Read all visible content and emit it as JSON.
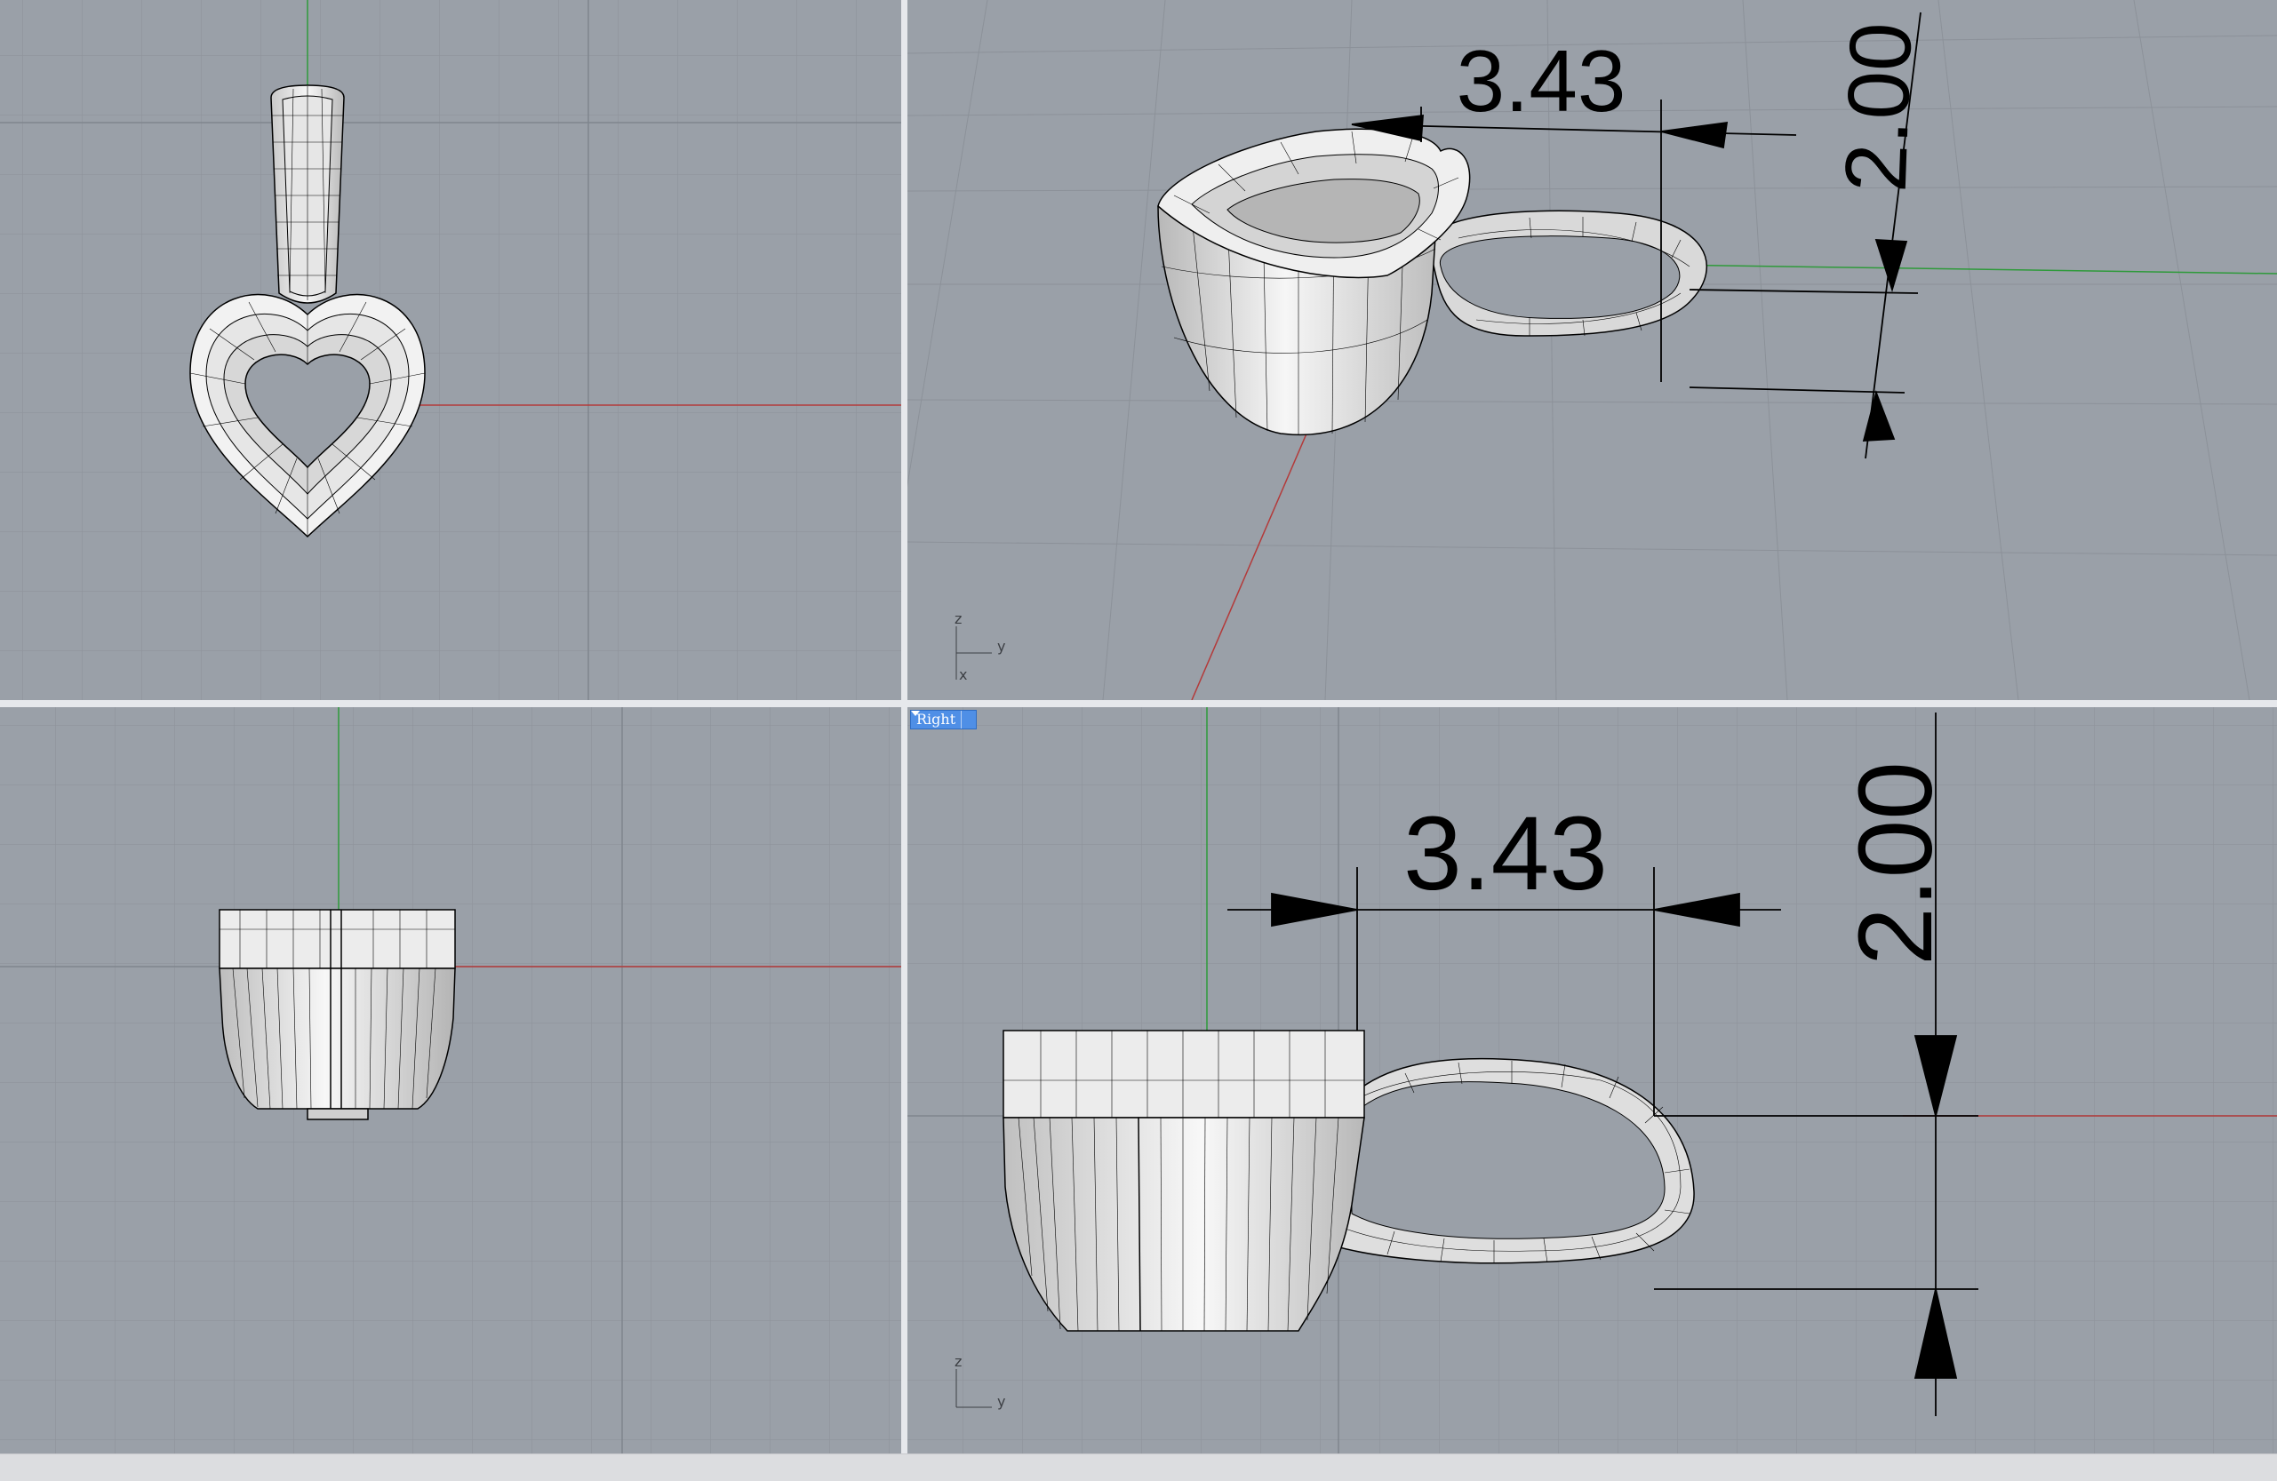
{
  "viewports": {
    "top": {},
    "perspective": {
      "dimension_width": "3.43",
      "dimension_height": "2.00",
      "axis_labels": {
        "z": "z",
        "y": "y",
        "x": "x"
      }
    },
    "front": {},
    "right": {
      "label": "Right",
      "dimension_width": "3.43",
      "dimension_height": "2.00",
      "axis_labels": {
        "z": "z",
        "y": "y"
      }
    }
  },
  "icons": {
    "viewport_menu": "chevron-down-icon"
  },
  "colors": {
    "background": "#9aa0a8",
    "grid_line": "#8a9098",
    "x_axis": "#b33a3a",
    "y_axis": "#2e9a3a",
    "active_label": "#4f8fe6",
    "model_fill": "#eeeeee"
  }
}
